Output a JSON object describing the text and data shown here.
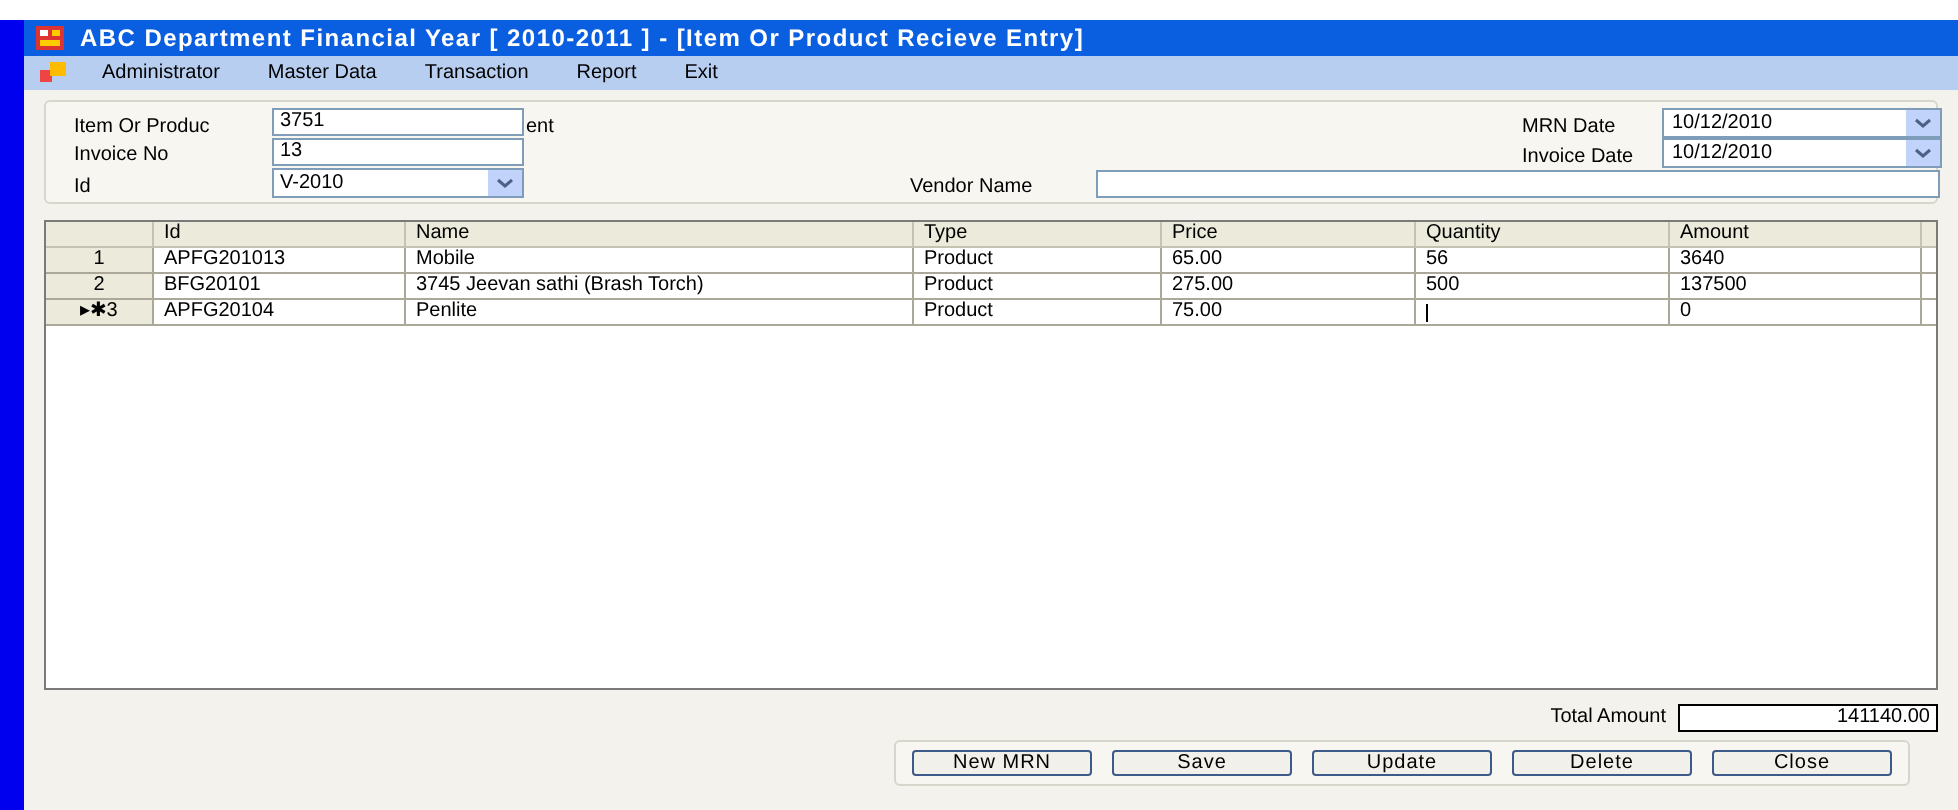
{
  "window": {
    "title": "ABC Department Financial Year [ 2010-2011 ] - [Item Or Product Recieve Entry]"
  },
  "menu": [
    "Administrator",
    "Master Data",
    "Transaction",
    "Report",
    "Exit"
  ],
  "form": {
    "item_label": "Item Or Produc",
    "item_value": "3751",
    "item_label_tail": "ent",
    "invoice_no_label": "Invoice No",
    "invoice_no_value": "13",
    "id_label": "Id",
    "id_value": "V-2010",
    "vendor_name_label": "Vendor Name",
    "mrn_date_label": "MRN Date",
    "mrn_date_value": "10/12/2010",
    "invoice_date_label": "Invoice Date",
    "invoice_date_value": "10/12/2010"
  },
  "table": {
    "columns": [
      "Id",
      "Name",
      "Type",
      "Price",
      "Quantity",
      "Amount"
    ],
    "rows": [
      {
        "header": "1",
        "cells": [
          "APFG201013",
          "Mobile",
          "Product",
          "65.00",
          "56",
          "3640"
        ],
        "editing": false
      },
      {
        "header": "2",
        "cells": [
          "BFG20101",
          "3745 Jeevan sathi (Brash Torch)",
          "Product",
          "275.00",
          "500",
          "137500"
        ],
        "editing": false
      },
      {
        "header": "▸✱3",
        "cells": [
          "APFG20104",
          "Penlite",
          "Product",
          "75.00",
          "",
          "0"
        ],
        "editing": true
      }
    ]
  },
  "total": {
    "label": "Total Amount",
    "value": "141140.00"
  },
  "buttons": [
    "New MRN",
    "Save",
    "Update",
    "Delete",
    "Close"
  ]
}
